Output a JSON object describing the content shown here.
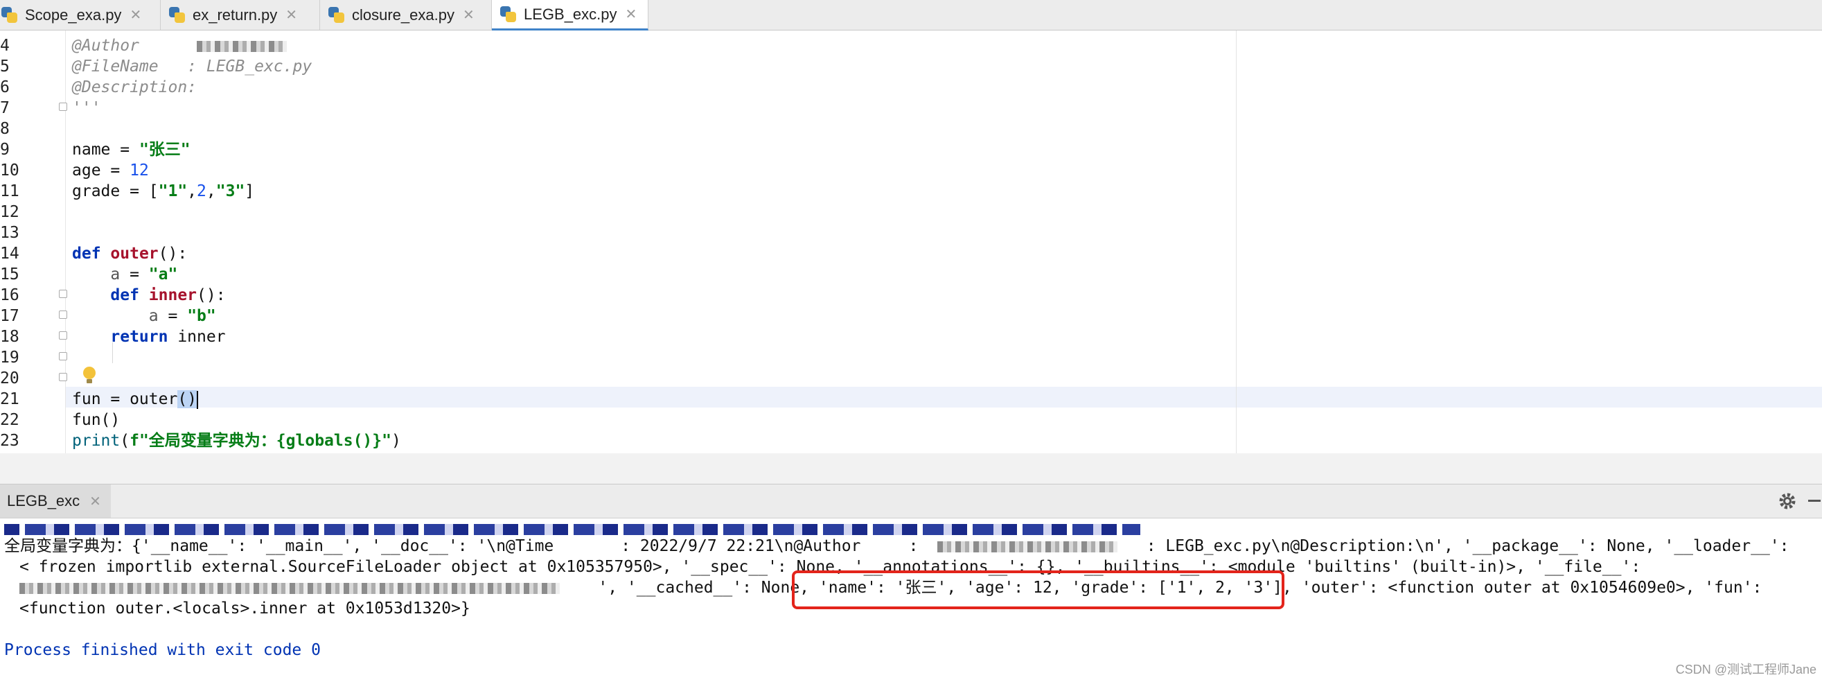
{
  "tabs": [
    {
      "label": "Scope_exa.py",
      "active": false
    },
    {
      "label": "ex_return.py",
      "active": false
    },
    {
      "label": "closure_exa.py",
      "active": false
    },
    {
      "label": "LEGB_exc.py",
      "active": true
    }
  ],
  "editor": {
    "line_numbers": [
      "4",
      "5",
      "6",
      "7",
      "8",
      "9",
      "10",
      "11",
      "12",
      "13",
      "14",
      "15",
      "16",
      "17",
      "18",
      "19",
      "20",
      "21",
      "22",
      "23"
    ],
    "author_tag": "@Author",
    "filename_tag": "@FileName",
    "filename_value": ": LEGB_exc.py",
    "description_tag": "@Description:",
    "docstring_close": "'''",
    "name_lhs": "name = ",
    "name_val": "\"张三\"",
    "age_lhs": "age = ",
    "age_val": "12",
    "grade_lhs": "grade = [",
    "grade_1": "\"1\"",
    "grade_comma1": ",",
    "grade_2": "2",
    "grade_comma2": ",",
    "grade_3": "\"3\"",
    "grade_close": "]",
    "def_kw": "def",
    "outer_name": "outer",
    "outer_sig": "():",
    "a_var": "a",
    "a_assign": " = ",
    "a_val": "\"a\"",
    "inner_name": "inner",
    "inner_sig": "():",
    "b_val": "\"b\"",
    "return_kw": "return",
    "return_val": " inner",
    "fun_assign": "fun = outer",
    "fun_paren": "()",
    "fun_call": "fun()",
    "print_fn": "print",
    "print_open": "(",
    "print_fstr": "f\"全局变量字典为：{globals()}\"",
    "print_close": ")"
  },
  "run_panel": {
    "tab_label": "LEGB_exc",
    "output_line1": "全局变量字典为：{'__name__': '__main__', '__doc__': '\\n@Time       : 2022/9/7 22:21\\n@Author     :",
    "output_line1b": ": LEGB_exc.py\\n@Description:\\n', '__package__': None, '__loader__':",
    "output_line2": "< frozen importlib external.SourceFileLoader object at 0x105357950>, '__spec__': None, '__annotations__': {}, '__builtins__': <module 'builtins' (built-in)>, '__file__':",
    "output_line3a": "', '__cached__': None, ",
    "output_line3_highlight": "'name': '张三', 'age': 12, 'grade': ['1', 2, '3'],",
    "output_line3b": " 'outer': <function outer at 0x1054609e0>, 'fun':",
    "output_line4": "<function outer.<locals>.inner at 0x1053d1320>}",
    "exit_message": "Process finished with exit code 0"
  },
  "watermark": "CSDN @测试工程师Jane"
}
